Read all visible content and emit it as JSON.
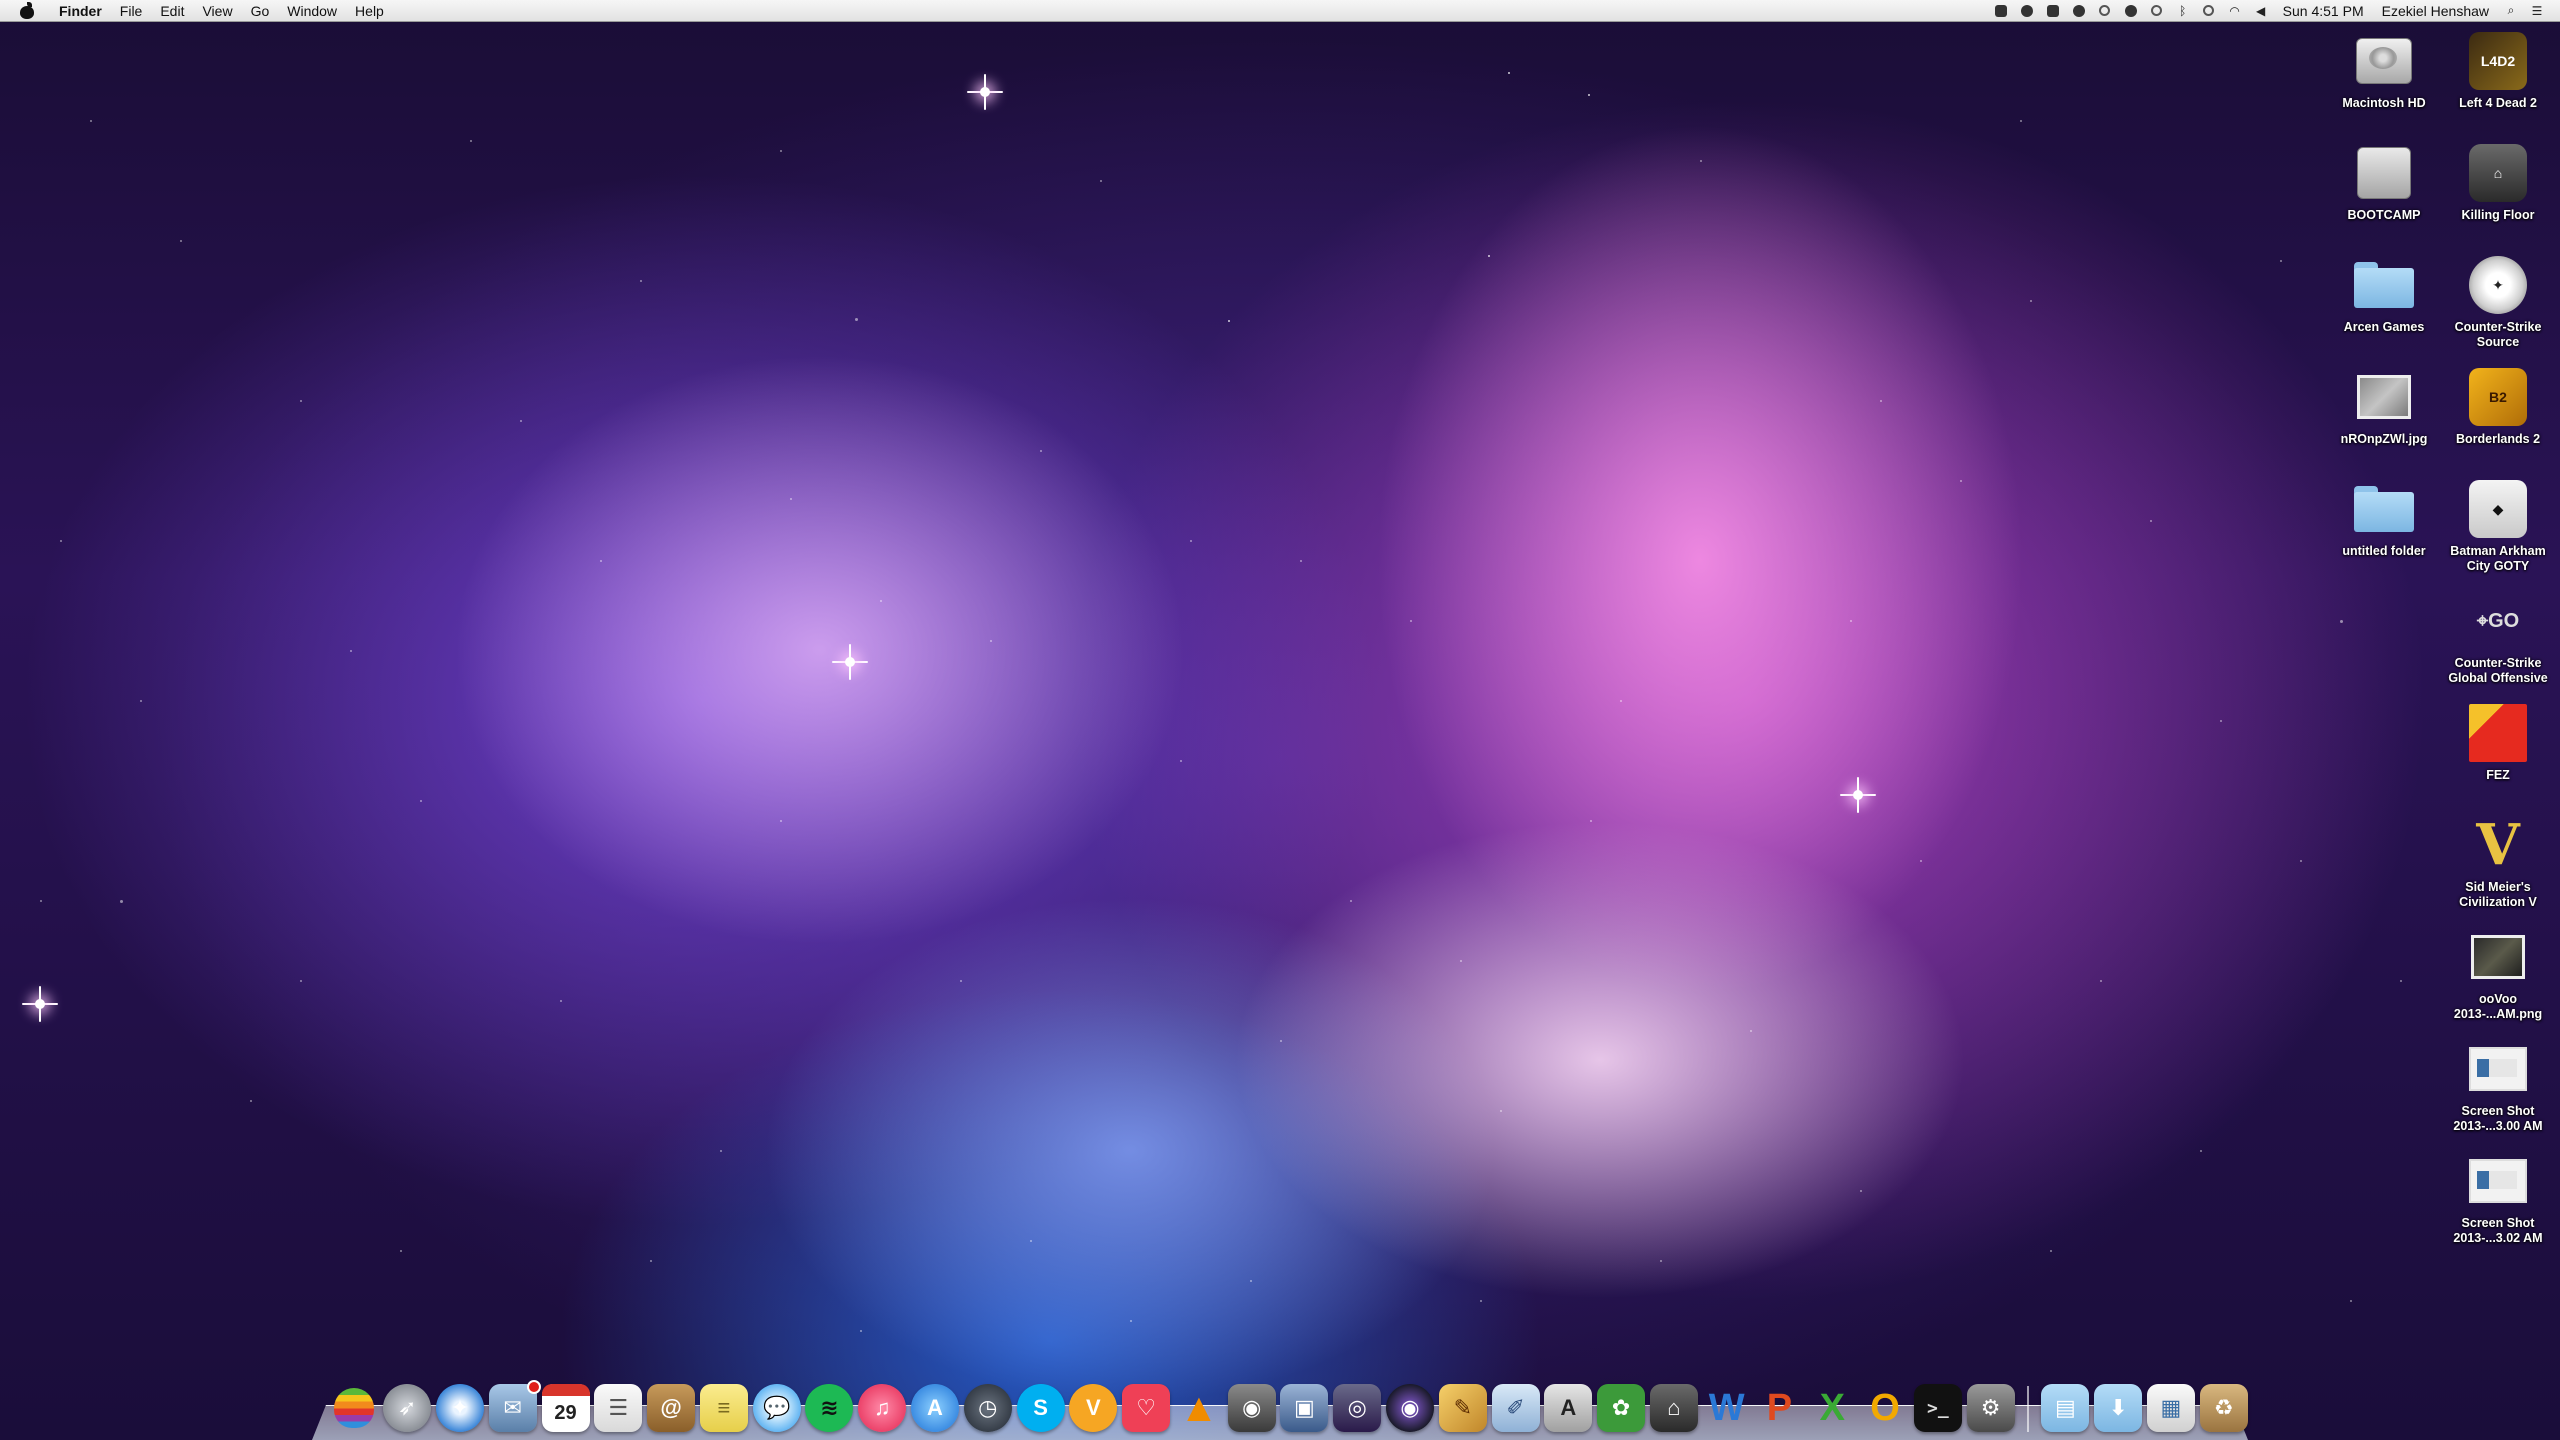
{
  "menubar": {
    "app_name": "Finder",
    "items": [
      "File",
      "Edit",
      "View",
      "Go",
      "Window",
      "Help"
    ],
    "clock": "Sun 4:51 PM",
    "user": "Ezekiel Henshaw"
  },
  "desktop_icons": {
    "col1": [
      {
        "label": "Macintosh HD"
      },
      {
        "label": "BOOTCAMP"
      },
      {
        "label": "Arcen Games"
      },
      {
        "label": "nROnpZWl.jpg"
      },
      {
        "label": "untitled folder"
      }
    ],
    "col2": [
      {
        "label": "Left 4 Dead 2"
      },
      {
        "label": "Killing Floor"
      },
      {
        "label": "Counter-Strike Source"
      },
      {
        "label": "Borderlands 2"
      },
      {
        "label": "Batman Arkham City GOTY"
      },
      {
        "label": "Counter-Strike Global Offensive"
      },
      {
        "label": "FEZ"
      },
      {
        "label": "Sid Meier's Civilization V"
      },
      {
        "label": "ooVoo 2013-...AM.png"
      },
      {
        "label": "Screen Shot 2013-...3.00 AM"
      },
      {
        "label": "Screen Shot 2013-...3.02 AM"
      }
    ]
  },
  "dock": {
    "calendar_day": "29",
    "app_letters": {
      "skype": "S",
      "vienna": "V",
      "word": "W",
      "powerpoint": "P",
      "excel": "X",
      "outlook": "O"
    }
  }
}
